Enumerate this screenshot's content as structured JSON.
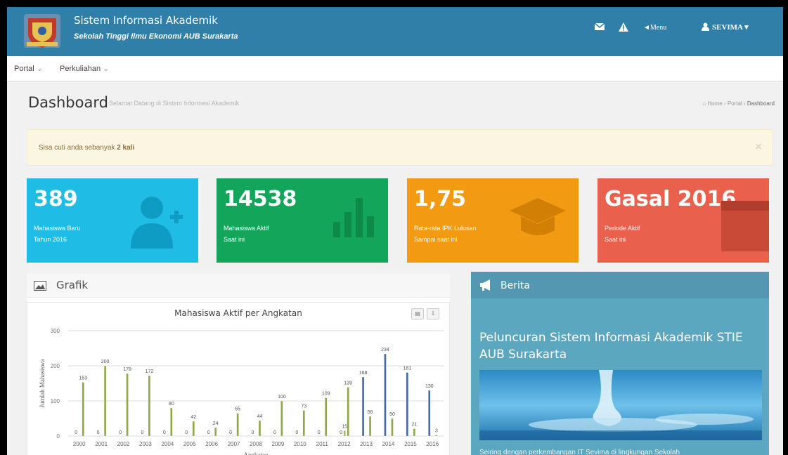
{
  "header": {
    "app_title": "Sistem Informasi Akademik",
    "institution": "Sekolah Tinggi Ilmu Ekonomi AUB Surakarta",
    "menu_label": "Menu",
    "user_label": "SEVIMA",
    "icons": [
      "envelope-icon",
      "alert-icon",
      "menu-icon",
      "user-icon"
    ]
  },
  "nav": {
    "items": [
      {
        "label": "Portal"
      },
      {
        "label": "Perkuliahan"
      }
    ]
  },
  "page": {
    "title": "Dashboard",
    "subtitle": "Selamat Datang di Sistem Informasi Akademik",
    "breadcrumb": [
      "Home",
      "Portal",
      "Dashboard"
    ]
  },
  "alert": {
    "prefix": "Sisa cuti anda sebanyak ",
    "value": "2 kali",
    "close": "×"
  },
  "stats": [
    {
      "value": "389",
      "line1": "Mahasiswa Baru",
      "line2": "Tahun 2016",
      "color": "#1fbde5",
      "icon": "add-user-icon"
    },
    {
      "value": "14538",
      "line1": "Mahasiswa Aktif",
      "line2": "Saat ini",
      "color": "#13a55a",
      "icon": "bar-chart-icon"
    },
    {
      "value": "1,75",
      "line1": "Rata-rata IPK Lulusan",
      "line2": "Sampai saat ini",
      "color": "#f29a12",
      "icon": "graduation-cap-icon"
    },
    {
      "value": "Gasal 2016",
      "line1": "Periode Aktif",
      "line2": "Saat ini",
      "color": "#e9604d",
      "icon": "calendar-icon"
    }
  ],
  "grafik": {
    "panel_title": "Grafik"
  },
  "berita": {
    "panel_title": "Berita",
    "headline": "Peluncuran Sistem Informasi Akademik STIE AUB Surakarta",
    "excerpt": "Seiring dengan perkembangan IT Sevima di lingkungan Sekolah"
  },
  "chart_data": {
    "type": "bar",
    "title": "Mahasiswa Aktif per Angkatan",
    "ylabel": "Jumlah Mahasiswa",
    "xlabel": "Angkatan",
    "ylim": [
      0,
      300
    ],
    "yticks": [
      0,
      100,
      200,
      300
    ],
    "grid": true,
    "categories": [
      "2000",
      "2001",
      "2002",
      "2003",
      "2004",
      "2005",
      "2006",
      "2007",
      "2008",
      "2009",
      "2010",
      "2011",
      "2012",
      "2013",
      "2014",
      "2015",
      "2016"
    ],
    "series": [
      {
        "color": "#4a6aa8",
        "values": [
          0,
          0,
          0,
          0,
          0,
          0,
          0,
          0,
          0,
          0,
          0,
          0,
          0,
          168,
          234,
          181,
          130
        ],
        "labels": [
          "0",
          "0",
          "0",
          "0",
          "0",
          "0",
          "0",
          "0",
          "0",
          "0",
          "0",
          "0",
          "0",
          "168",
          "234",
          "181",
          "130"
        ]
      },
      {
        "color": "#a6b96a",
        "values": [
          0,
          0,
          0,
          0,
          0,
          0,
          0,
          0,
          0,
          0,
          0,
          0,
          15,
          0,
          0,
          0,
          0
        ],
        "labels": [
          "0",
          "0",
          "0",
          "0",
          "0",
          "0",
          "0",
          "0",
          "0",
          "0",
          "0",
          "1",
          "15",
          "0",
          "0",
          "0",
          "1"
        ]
      },
      {
        "color": "#8fa84d",
        "values": [
          153,
          200,
          178,
          172,
          80,
          42,
          24,
          65,
          44,
          100,
          73,
          109,
          139,
          56,
          50,
          21,
          3
        ],
        "labels": [
          "153",
          "200",
          "178",
          "172",
          "80",
          "42",
          "24",
          "65",
          "44",
          "100",
          "73",
          "109",
          "139",
          "56",
          "50",
          "21",
          "3"
        ]
      }
    ]
  }
}
